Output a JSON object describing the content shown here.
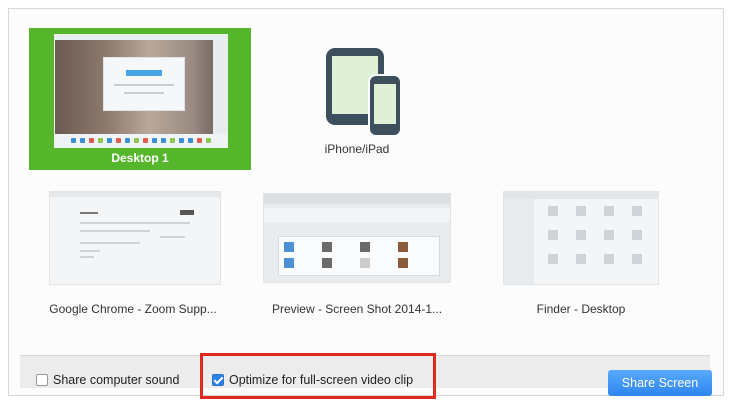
{
  "tiles": [
    {
      "label": "Desktop 1",
      "selected": true
    },
    {
      "label": "iPhone/iPad",
      "selected": false
    },
    {
      "label": "Google Chrome - Zoom Supp...",
      "selected": false
    },
    {
      "label": "Preview - Screen Shot 2014-1...",
      "selected": false
    },
    {
      "label": "Finder - Desktop",
      "selected": false
    }
  ],
  "options": {
    "share_sound_label": "Share computer sound",
    "share_sound_checked": false,
    "optimize_video_label": "Optimize for full-screen video clip",
    "optimize_video_checked": true
  },
  "share_button_label": "Share Screen",
  "colors": {
    "selected_tile": "#55b62b",
    "highlight_box": "#e02a1e",
    "checkbox_on": "#2d82e6",
    "button": "#2d86ee"
  },
  "icons": {
    "device": "ipad-iphone-icon"
  }
}
